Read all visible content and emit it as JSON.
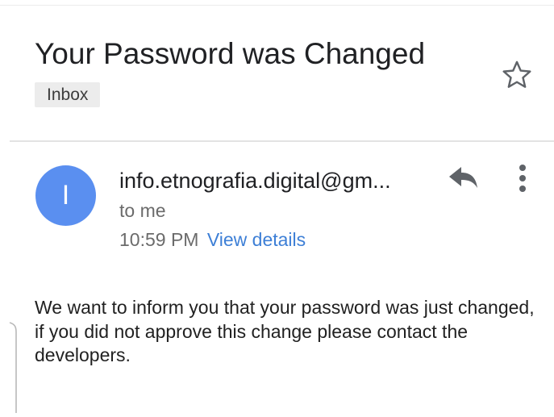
{
  "message": {
    "subject": "Your Password was Changed",
    "label": "Inbox",
    "sender": {
      "initial": "I",
      "address": "info.etnografia.digital@gm..."
    },
    "recipient": "to me",
    "time": "10:59 PM",
    "view_details": "View details",
    "body": "We want to inform you that your password was just changed, if you did not approve this change please contact the developers."
  },
  "icons": {
    "star": "star-outline-icon",
    "reply": "reply-icon",
    "more": "more-vert-icon"
  },
  "colors": {
    "avatar": "#5a8ff0",
    "link": "#3d7fd6",
    "label_chip": "#ececec"
  }
}
